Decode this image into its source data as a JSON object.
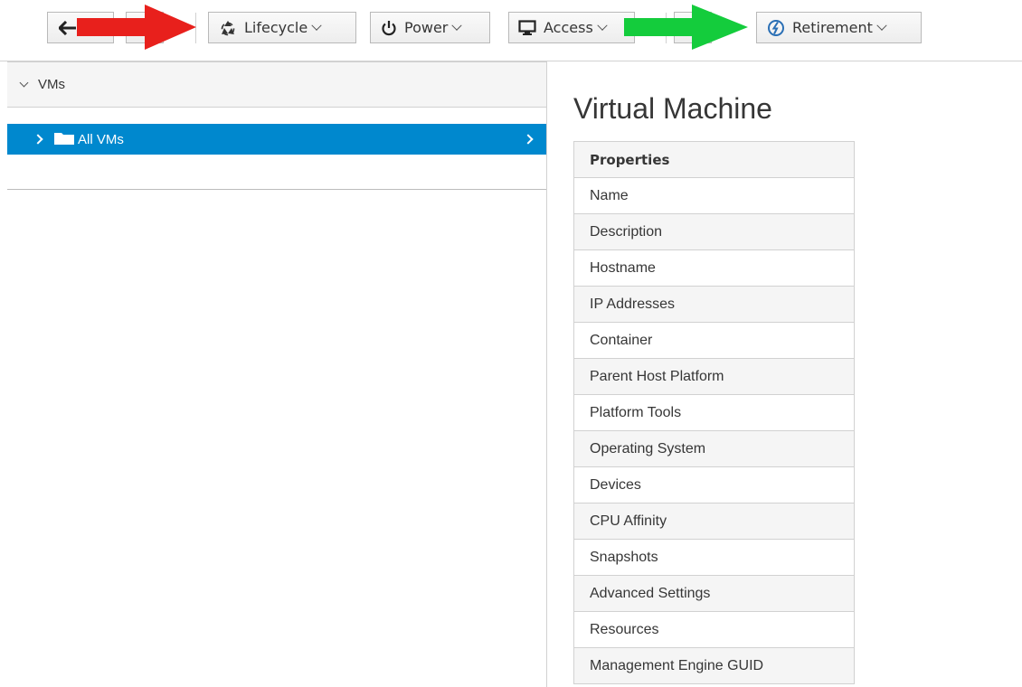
{
  "toolbar": {
    "lifecycle_label": "Lifecycle",
    "power_label": "Power",
    "access_label": "Access",
    "retirement_label": "Retirement",
    "icons": {
      "back": "back-arrow-icon",
      "lifecycle": "recycle-icon",
      "power": "power-icon",
      "access": "monitor-icon",
      "retirement": "retirement-icon"
    }
  },
  "annotations": {
    "red_arrow_color": "#e8201c",
    "green_arrow_color": "#14cc3c"
  },
  "sidebar": {
    "header": "VMs",
    "tree_item": "All VMs",
    "selected_color": "#0088ce"
  },
  "main": {
    "title": "Virtual Machine",
    "table_header": "Properties",
    "rows": [
      "Name",
      "Description",
      "Hostname",
      "IP Addresses",
      "Container",
      "Parent Host Platform",
      "Platform Tools",
      "Operating System",
      "Devices",
      "CPU Affinity",
      "Snapshots",
      "Advanced Settings",
      "Resources",
      "Management Engine GUID"
    ]
  }
}
